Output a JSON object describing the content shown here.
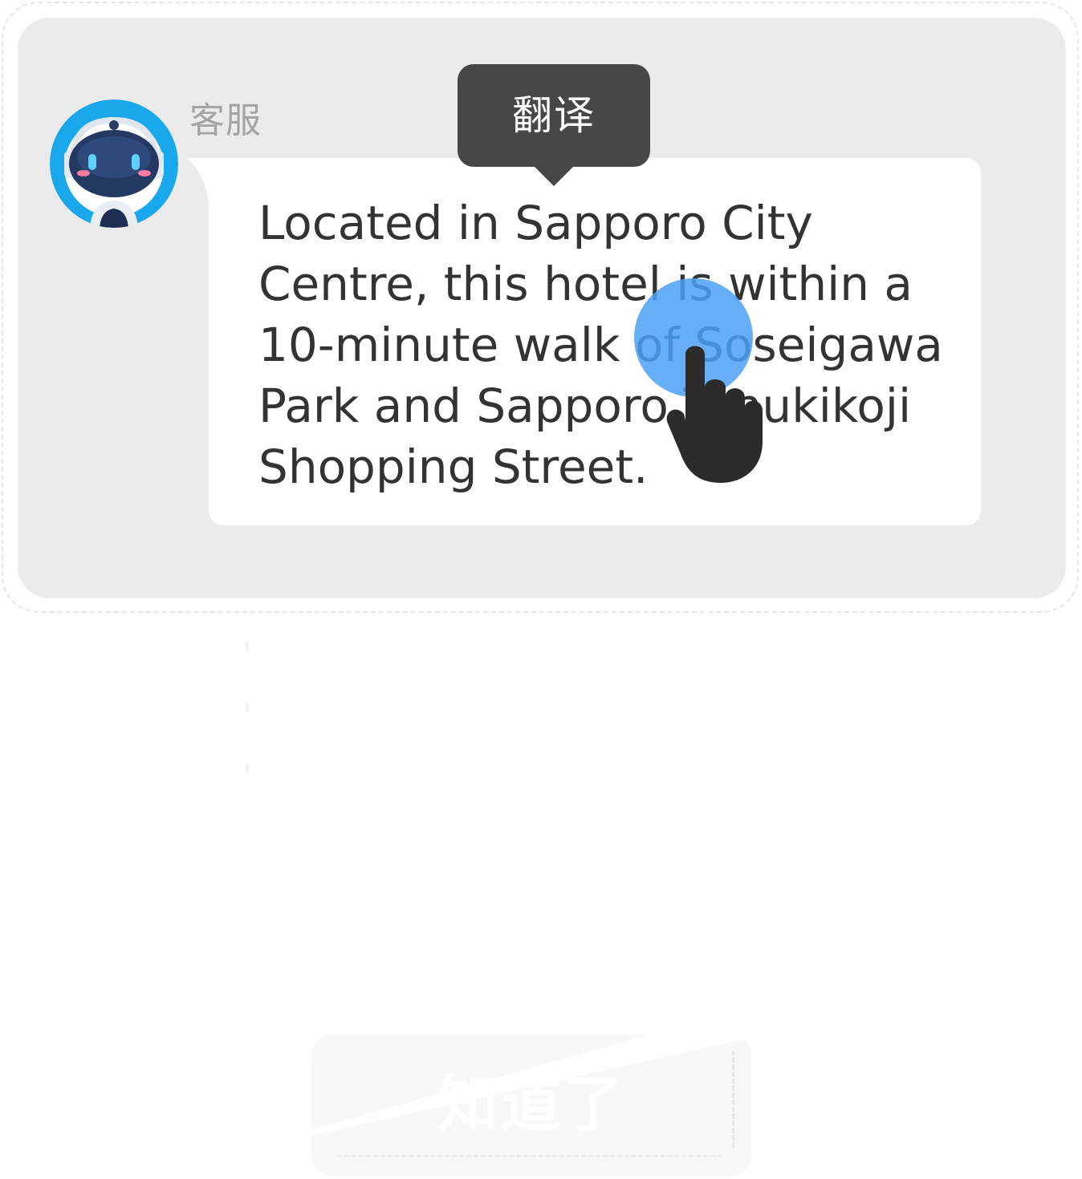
{
  "chat": {
    "sender_name": "客服",
    "message": "Located in Sapporo City\nCentre, this hotel is within a\n10-minute walk of Soseigawa\nPark and Sapporo Tanukikoji\nShopping Street.",
    "avatar_icon": "robot-avatar-icon"
  },
  "context_menu": {
    "translate_label": "翻译"
  },
  "gesture": {
    "icon": "pointing-hand-icon",
    "touch_color": "#4ba1f5"
  },
  "footer": {
    "got_it_label": "知道了"
  },
  "colors": {
    "card_background": "#ebebeb",
    "tooltip_background": "#474747",
    "avatar_ring": "#1aa8ec"
  }
}
